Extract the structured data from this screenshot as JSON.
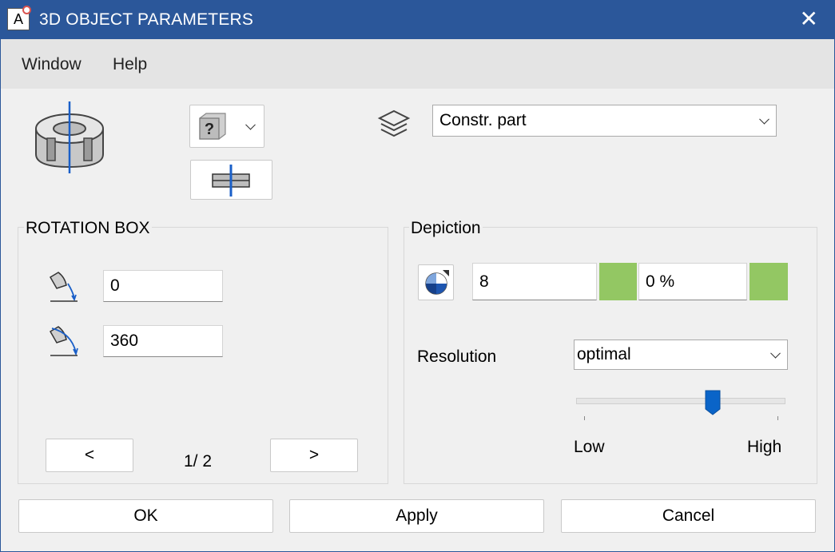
{
  "window": {
    "title": "3D OBJECT PARAMETERS",
    "app_icon_letter": "A"
  },
  "menu": {
    "items": [
      "Window",
      "Help"
    ]
  },
  "toolbar": {
    "object_icon": "ring-object-icon",
    "material_icon": "unknown-material-icon",
    "section_icon": "section-plane-icon",
    "layer_icon": "layers-icon",
    "layer_value": "Constr. part"
  },
  "rotation_box": {
    "title": "ROTATION BOX",
    "start_angle": "0",
    "end_angle": "360",
    "prev_label": "<",
    "next_label": ">",
    "page": "1/ 2"
  },
  "depiction": {
    "title": "Depiction",
    "pen_value": "8",
    "transparency_value": "0 %",
    "swatch_color": "#93c763",
    "resolution_label": "Resolution",
    "resolution_value": "optimal",
    "slider_low": "Low",
    "slider_high": "High",
    "slider_level": 0.65
  },
  "buttons": {
    "ok": "OK",
    "apply": "Apply",
    "cancel": "Cancel"
  },
  "colors": {
    "titlebar": "#2b579a",
    "accent": "#0a64c8"
  }
}
